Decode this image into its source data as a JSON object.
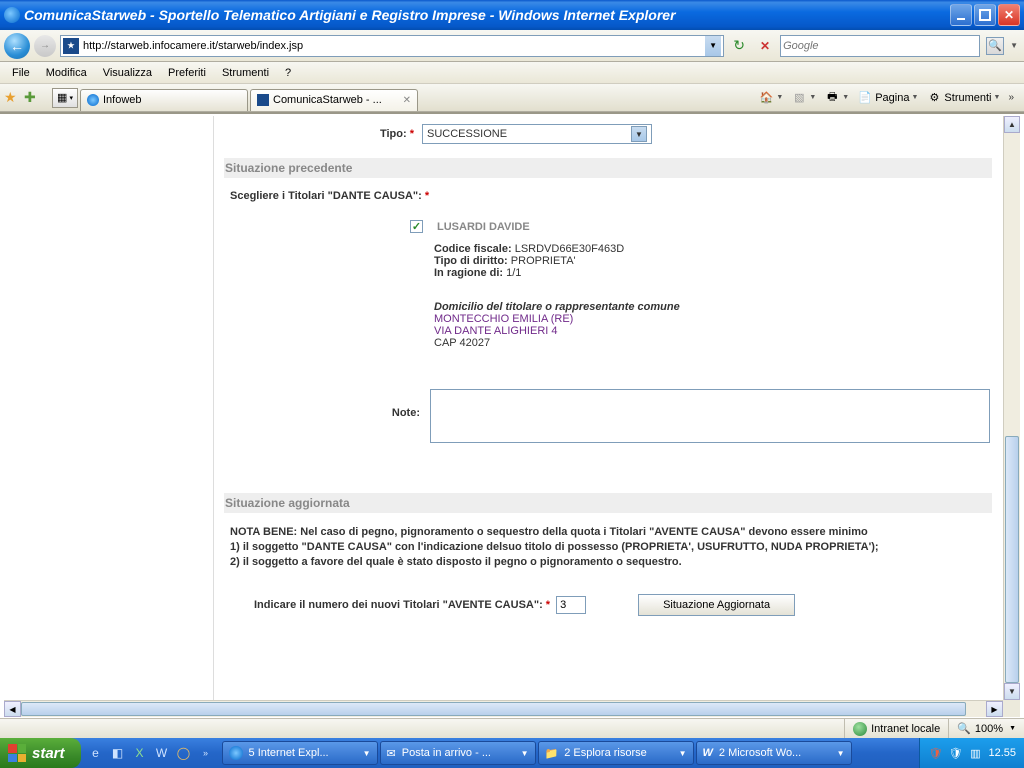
{
  "window": {
    "title": "ComunicaStarweb - Sportello Telematico Artigiani e Registro Imprese - Windows Internet Explorer"
  },
  "nav": {
    "url": "http://starweb.infocamere.it/starweb/index.jsp",
    "search_placeholder": "Google"
  },
  "menu": {
    "file": "File",
    "edit": "Modifica",
    "view": "Visualizza",
    "fav": "Preferiti",
    "tools": "Strumenti",
    "help": "?"
  },
  "tabs": {
    "t1": "Infoweb",
    "t2": "ComunicaStarweb - ..."
  },
  "toolbar": {
    "page": "Pagina",
    "tools": "Strumenti"
  },
  "form": {
    "tipo_label": "Tipo:",
    "tipo_value": "SUCCESSIONE",
    "section_prev": "Situazione precedente",
    "scegliere": "Scegliere i Titolari \"DANTE CAUSA\":",
    "titolare_name": "LUSARDI DAVIDE",
    "cf_label": "Codice fiscale:",
    "cf_value": "LSRDVD66E30F463D",
    "diritto_label": "Tipo di diritto:",
    "diritto_value": "PROPRIETA'",
    "ragione_label": "In ragione di:",
    "ragione_value": "1/1",
    "domicilio_header": "Domicilio del titolare o rappresentante comune",
    "dom_line1": "MONTECCHIO EMILIA (RE)",
    "dom_line2": "VIA DANTE ALIGHIERI 4",
    "dom_line3": "CAP 42027",
    "note_label": "Note:",
    "section_agg": "Situazione aggiornata",
    "nota_bene": "NOTA BENE: Nel caso di pegno, pignoramento o sequestro della quota i Titolari \"AVENTE CAUSA\" devono essere minimo",
    "nota_1": "1) il soggetto \"DANTE CAUSA\" con l'indicazione delsuo titolo di possesso (PROPRIETA', USUFRUTTO, NUDA PROPRIETA');",
    "nota_2": "2) il soggetto a favore del quale è stato disposto il pegno o pignoramento o sequestro.",
    "indicare": "Indicare il numero dei nuovi Titolari \"AVENTE CAUSA\":",
    "num_value": "3",
    "btn_situazione": "Situazione Aggiornata"
  },
  "status": {
    "zone": "Intranet locale",
    "zoom": "100%"
  },
  "taskbar": {
    "start": "start",
    "t1": "5 Internet Expl...",
    "t2": "Posta in arrivo - ...",
    "t3": "2 Esplora risorse",
    "t4": "2 Microsoft Wo...",
    "clock": "12.55"
  }
}
